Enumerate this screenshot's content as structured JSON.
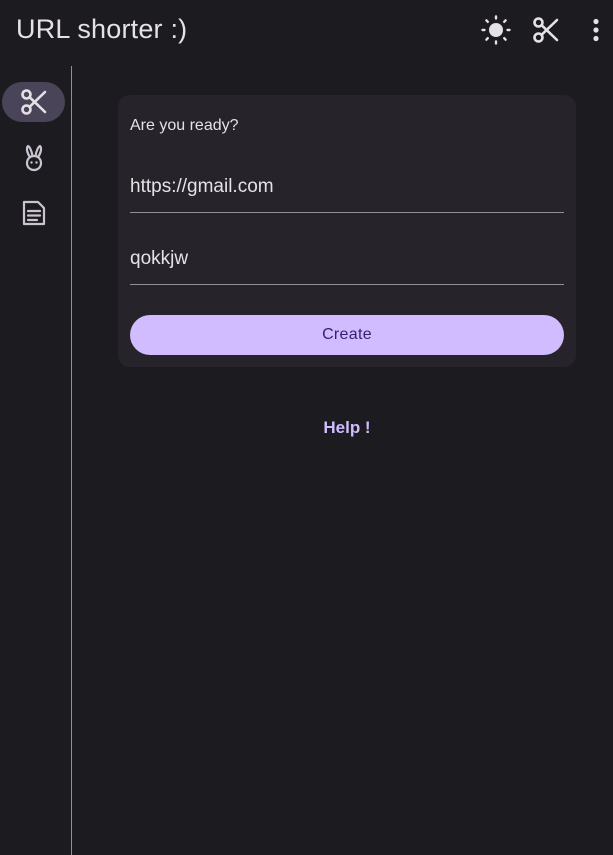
{
  "app": {
    "title": "URL shorter :)"
  },
  "topbar": {
    "actions": [
      {
        "icon": "sun-icon",
        "label": "Toggle theme"
      },
      {
        "icon": "scissors-icon",
        "label": "Shorten"
      },
      {
        "icon": "more-vert-icon",
        "label": "More"
      }
    ]
  },
  "rail": {
    "items": [
      {
        "icon": "scissors-icon",
        "active": true
      },
      {
        "icon": "rabbit-icon",
        "active": false
      },
      {
        "icon": "article-icon",
        "active": false
      }
    ]
  },
  "card": {
    "title": "Are you ready?",
    "url_value": "https://gmail.com",
    "code_value": "qokkjw",
    "create_label": "Create"
  },
  "help": {
    "label": "Help !"
  },
  "colors": {
    "background": "#1c1b1f",
    "surface": "#26232b",
    "primary": "#d0bcff",
    "on_primary": "#381e72",
    "rail_active": "#4a4458",
    "outline": "#938f99",
    "on_surface": "#e6e1e5"
  }
}
